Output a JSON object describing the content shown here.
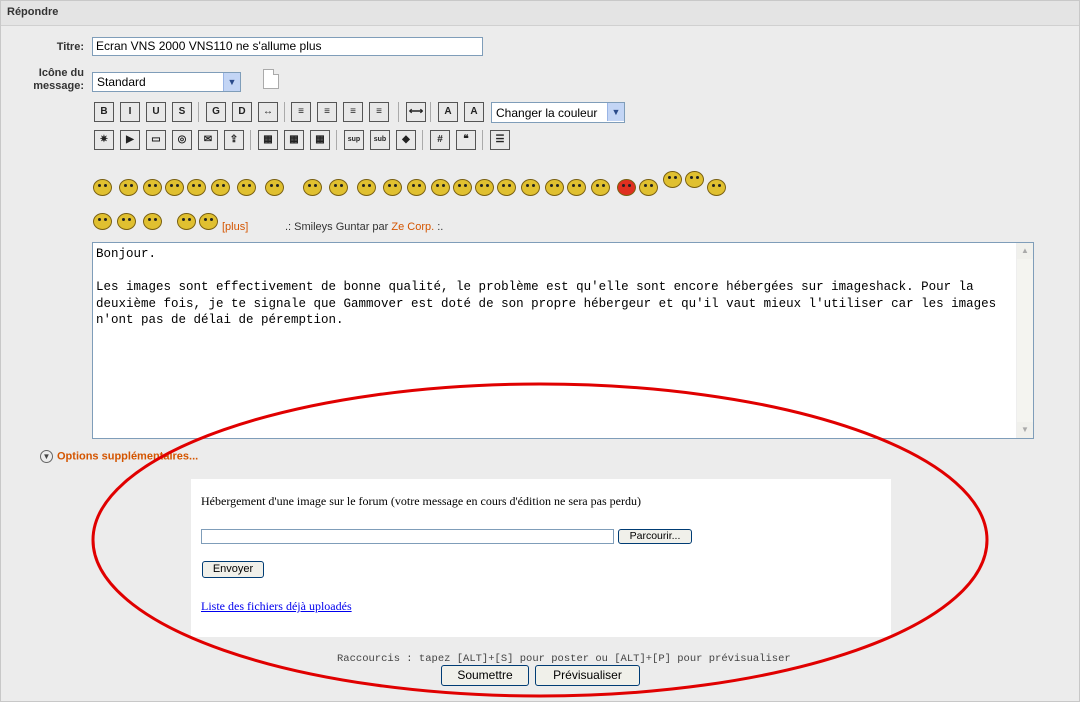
{
  "header": {
    "title": "Répondre"
  },
  "form": {
    "title_label": "Titre:",
    "title_value": "Ecran VNS 2000 VNS110  ne s'allume plus",
    "icon_label_line1": "Icône du",
    "icon_label_line2": "message:",
    "icon_value": "Standard"
  },
  "toolbar": {
    "row1": [
      {
        "name": "bold-button",
        "glyph": "B"
      },
      {
        "name": "italic-button",
        "glyph": "I"
      },
      {
        "name": "underline-button",
        "glyph": "U"
      },
      {
        "name": "strike-button",
        "glyph": "S"
      },
      {
        "name": "align-left-button",
        "glyph": "G"
      },
      {
        "name": "align-right-button",
        "glyph": "D"
      },
      {
        "name": "justify-button",
        "glyph": "↔"
      },
      {
        "name": "left-text-button",
        "glyph": "≡"
      },
      {
        "name": "right-text-button",
        "glyph": "≡"
      },
      {
        "name": "center-text-button",
        "glyph": "≡"
      },
      {
        "name": "full-text-button",
        "glyph": "≡"
      },
      {
        "name": "hr-button",
        "glyph": "⟷"
      },
      {
        "name": "size-button",
        "glyph": "A"
      },
      {
        "name": "color-button",
        "glyph": "A"
      }
    ],
    "color_select": "Changer la couleur",
    "row2": [
      {
        "name": "flash-button",
        "glyph": "✷"
      },
      {
        "name": "youtube-button",
        "glyph": "▶"
      },
      {
        "name": "image-button",
        "glyph": "▭"
      },
      {
        "name": "link-button",
        "glyph": "◎"
      },
      {
        "name": "email-button",
        "glyph": "✉"
      },
      {
        "name": "upload-button",
        "glyph": "⇪"
      },
      {
        "name": "table-button",
        "glyph": "▦"
      },
      {
        "name": "table-row-button",
        "glyph": "▦"
      },
      {
        "name": "table-col-button",
        "glyph": "▦"
      },
      {
        "name": "sup-button",
        "glyph": "sup"
      },
      {
        "name": "sub-button",
        "glyph": "sub"
      },
      {
        "name": "code-button",
        "glyph": "◆"
      },
      {
        "name": "hash-button",
        "glyph": "#"
      },
      {
        "name": "quote-button",
        "glyph": "❝"
      },
      {
        "name": "list-button",
        "glyph": "☰"
      }
    ]
  },
  "smileys": {
    "plus_label": "[plus]",
    "credit_prefix": ".: Smileys Guntar par ",
    "credit_link": "Ze Corp.",
    "credit_suffix": " :."
  },
  "message": {
    "body": "Bonjour.\n\nLes images sont effectivement de bonne qualité, le problème est qu'elle sont encore hébergées sur imageshack. Pour la deuxième fois, je te signale que Gammover est doté de son propre hébergeur et qu'il vaut mieux l'utiliser car les images n'ont pas de délai de péremption."
  },
  "options": {
    "label": "Options supplémentaires..."
  },
  "upload": {
    "heading": "Hébergement d'une image sur le forum (votre message en cours d'édition ne sera pas perdu)",
    "browse_label": "Parcourir...",
    "send_label": "Envoyer",
    "list_link": "Liste des fichiers déjà uploadés"
  },
  "footer": {
    "shortcut": "Raccourcis : tapez [ALT]+[S] pour poster ou [ALT]+[P] pour prévisualiser",
    "submit_label": "Soumettre",
    "preview_label": "Prévisualiser"
  },
  "colors": {
    "accent": "#d45500",
    "annotation": "#e00000",
    "link": "#0000ee"
  }
}
